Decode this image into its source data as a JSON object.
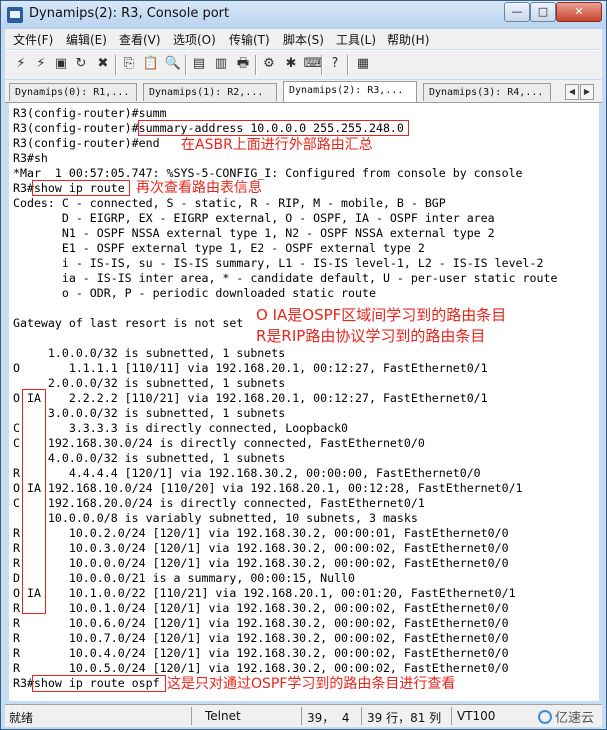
{
  "window": {
    "title": "Dynamips(2): R3, Console port",
    "controls": [
      "—",
      "□",
      "✕"
    ]
  },
  "menu": [
    "文件(F)",
    "编辑(E)",
    "查看(V)",
    "选项(O)",
    "传输(T)",
    "脚本(S)",
    "工具(L)",
    "帮助(H)"
  ],
  "toolbar": {
    "icons": [
      "connect-icon",
      "quick-connect-icon",
      "connect-tab-icon",
      "reconnect-icon",
      "disconnect-icon",
      "copy-icon",
      "paste-icon",
      "find-icon",
      "print-setup-icon",
      "print-icon",
      "printer-icon",
      "session-options-icon",
      "global-options-icon",
      "keymap-icon",
      "help-icon",
      "sftp-icon"
    ],
    "glyphs": [
      "⚡",
      "⚡",
      "▣",
      "↻",
      "✖",
      "⎘",
      "📋",
      "🔍",
      "▤",
      "▥",
      "🖶",
      "⚙",
      "✱",
      "⌨",
      "?",
      "▦"
    ]
  },
  "tabs": [
    "Dynamips(0): R1,...",
    "Dynamips(1): R2,...",
    "Dynamips(2): R3,...",
    "Dynamips(3): R4,..."
  ],
  "tab_nav": [
    "◀",
    "▶"
  ],
  "terminal": {
    "lines": [
      "R3(config-router)#summ",
      "R3(config-router)#summary-address 10.0.0.0 255.255.248.0",
      "R3(config-router)#end",
      "R3#sh",
      "*Mar  1 00:57:05.747: %SYS-5-CONFIG_I: Configured from console by console",
      "R3#show ip route",
      "Codes: C - connected, S - static, R - RIP, M - mobile, B - BGP",
      "       D - EIGRP, EX - EIGRP external, O - OSPF, IA - OSPF inter area",
      "       N1 - OSPF NSSA external type 1, N2 - OSPF NSSA external type 2",
      "       E1 - OSPF external type 1, E2 - OSPF external type 2",
      "       i - IS-IS, su - IS-IS summary, L1 - IS-IS level-1, L2 - IS-IS level-2",
      "       ia - IS-IS inter area, * - candidate default, U - per-user static route",
      "       o - ODR, P - periodic downloaded static route",
      "",
      "Gateway of last resort is not set",
      "",
      "     1.0.0.0/32 is subnetted, 1 subnets",
      "O       1.1.1.1 [110/11] via 192.168.20.1, 00:12:27, FastEthernet0/1",
      "     2.0.0.0/32 is subnetted, 1 subnets",
      "O IA    2.2.2.2 [110/21] via 192.168.20.1, 00:12:27, FastEthernet0/1",
      "     3.0.0.0/32 is subnetted, 1 subnets",
      "C       3.3.3.3 is directly connected, Loopback0",
      "C    192.168.30.0/24 is directly connected, FastEthernet0/0",
      "     4.0.0.0/32 is subnetted, 1 subnets",
      "R       4.4.4.4 [120/1] via 192.168.30.2, 00:00:00, FastEthernet0/0",
      "O IA 192.168.10.0/24 [110/20] via 192.168.20.1, 00:12:28, FastEthernet0/1",
      "C    192.168.20.0/24 is directly connected, FastEthernet0/1",
      "     10.0.0.0/8 is variably subnetted, 10 subnets, 3 masks",
      "R       10.0.2.0/24 [120/1] via 192.168.30.2, 00:00:01, FastEthernet0/0",
      "R       10.0.3.0/24 [120/1] via 192.168.30.2, 00:00:02, FastEthernet0/0",
      "R       10.0.0.0/24 [120/1] via 192.168.30.2, 00:00:02, FastEthernet0/0",
      "D       10.0.0.0/21 is a summary, 00:00:15, Null0",
      "O IA    10.1.0.0/22 [110/21] via 192.168.20.1, 00:01:20, FastEthernet0/1",
      "R       10.0.1.0/24 [120/1] via 192.168.30.2, 00:00:02, FastEthernet0/0",
      "R       10.0.6.0/24 [120/1] via 192.168.30.2, 00:00:02, FastEthernet0/0",
      "R       10.0.7.0/24 [120/1] via 192.168.30.2, 00:00:02, FastEthernet0/0",
      "R       10.0.4.0/24 [120/1] via 192.168.30.2, 00:00:02, FastEthernet0/0",
      "R       10.0.5.0/24 [120/1] via 192.168.30.2, 00:00:02, FastEthernet0/0",
      "R3#show ip route ospf"
    ]
  },
  "annotations": {
    "asbr_summary": "在ASBR上面进行外部路由汇总",
    "show_route_again": "再次查看路由表信息",
    "o_ia_meaning": "O IA是OSPF区域间学习到的路由条目",
    "r_meaning": "R是RIP路由协议学习到的路由条目",
    "show_ospf_only": "这是只对通过OSPF学习到的路由条目进行查看",
    "color": "#e8251d"
  },
  "status": {
    "ready": "就绪",
    "protocol": "Telnet",
    "cursor": "39，  4",
    "rows_cols": "39 行，81 列",
    "terminal_type": "VT100"
  },
  "logo": "亿速云"
}
